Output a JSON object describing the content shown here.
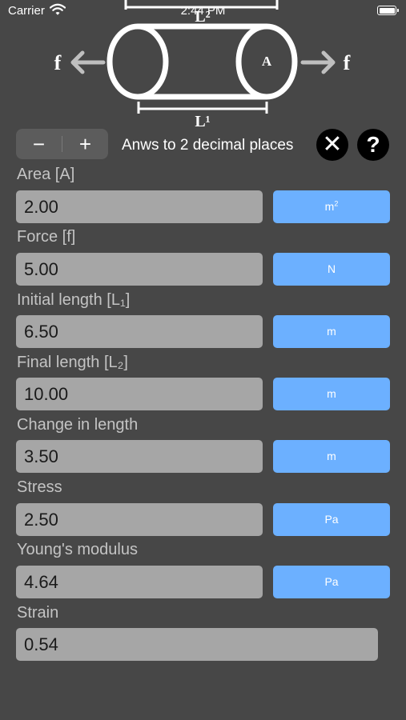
{
  "status_bar": {
    "carrier": "Carrier",
    "time": "2:44 PM"
  },
  "diagram": {
    "top_length_label": "L²",
    "bottom_length_label": "L¹",
    "area_label": "A",
    "force_left": "f",
    "force_right": "f"
  },
  "controls": {
    "decrement_label": "−",
    "increment_label": "+",
    "precision_label": "Anws to 2 decimal places",
    "clear_label": "✕",
    "help_label": "?"
  },
  "fields": [
    {
      "label": "Area [A]",
      "value": "2.00",
      "unit": "m",
      "unit_sup": "2"
    },
    {
      "label": "Force [f]",
      "value": "5.00",
      "unit": "N",
      "unit_sup": ""
    },
    {
      "label": "Initial length [L₁]",
      "value": "6.50",
      "unit": "m",
      "unit_sup": ""
    },
    {
      "label": "Final length [L₂]",
      "value": "10.00",
      "unit": "m",
      "unit_sup": ""
    },
    {
      "label": "Change in length",
      "value": "3.50",
      "unit": "m",
      "unit_sup": ""
    },
    {
      "label": "Stress",
      "value": "2.50",
      "unit": "Pa",
      "unit_sup": ""
    },
    {
      "label": "Young's modulus",
      "value": "4.64",
      "unit": "Pa",
      "unit_sup": ""
    },
    {
      "label": "Strain",
      "value": "0.54"
    }
  ],
  "colors": {
    "background": "#474747",
    "input_fill": "#a6a6a6",
    "unit_button": "#6cb0ff",
    "label_text": "#c4c4c4"
  }
}
